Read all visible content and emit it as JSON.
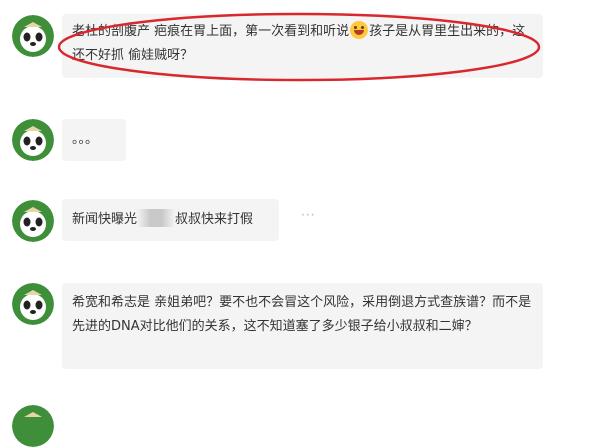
{
  "comments": [
    {
      "text_a": "老杜的剖腹产 疤痕在胃上面，第一次看到和听说",
      "emoji": "grinning-face-emoji",
      "text_b": "孩子是从胃里生出来的，这还不好抓 偷娃贼呀？"
    },
    {
      "text": "。。。"
    },
    {
      "text_a": "新闻快曝光",
      "text_b": "叔叔快来打假",
      "more": "···"
    },
    {
      "text": "希宽和希志是 亲姐弟吧？要不也不会冒这个风险，采用倒退方式查族谱？而不是先进的DNA对比他们的关系，这不知道塞了多少银子给小叔叔和二婶？"
    }
  ],
  "colors": {
    "bubble": "#f4f4f4",
    "text": "#333333",
    "annotation": "#d9272e",
    "avatar_bg": "#3f8f3a"
  }
}
